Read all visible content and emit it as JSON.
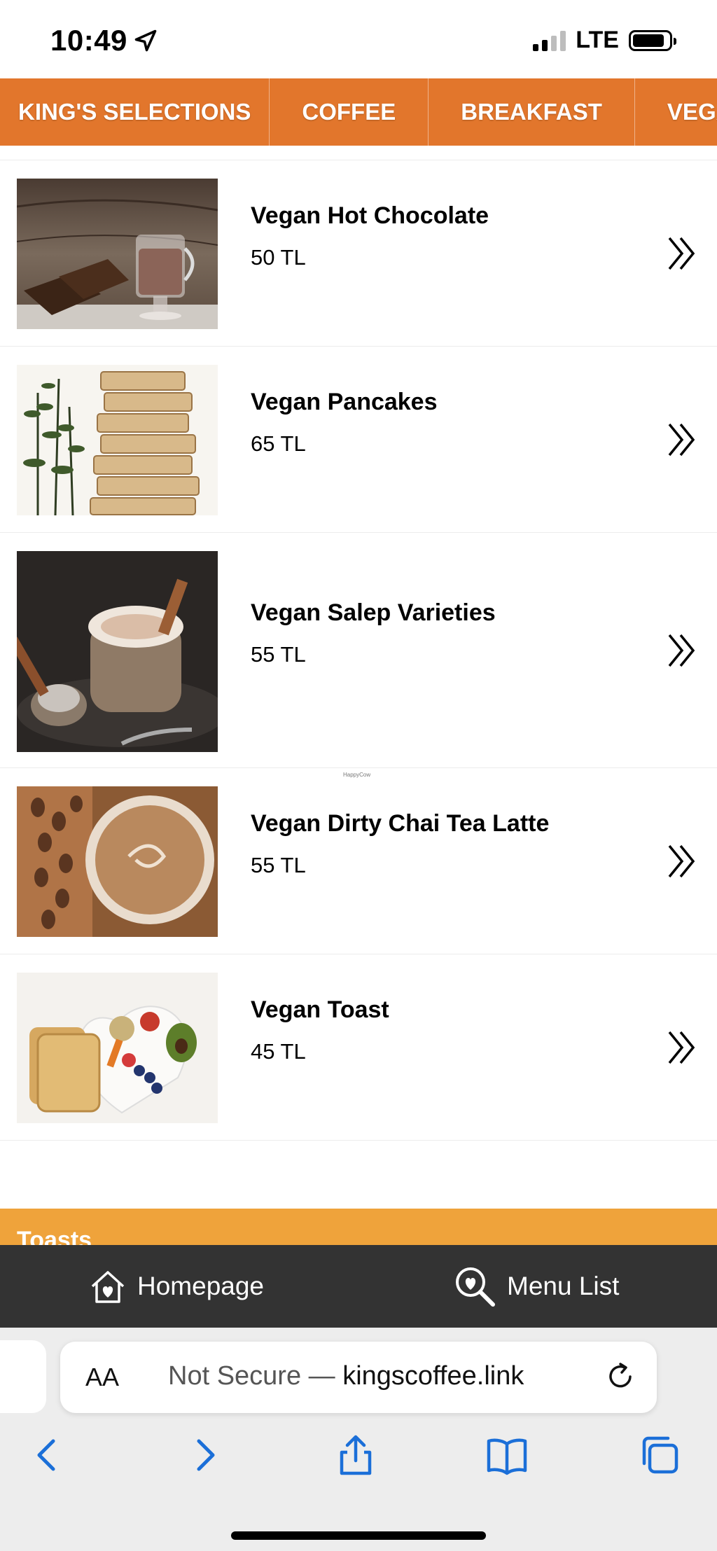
{
  "status_bar": {
    "time": "10:49",
    "network": "LTE",
    "icons": [
      "location-arrow-icon",
      "signal-icon",
      "battery-icon"
    ]
  },
  "categories": [
    "KING'S SELECTIONS",
    "COFFEE",
    "BREAKFAST",
    "VEGAN"
  ],
  "items": [
    {
      "name": "Vegan Hot Chocolate",
      "price": "50 TL"
    },
    {
      "name": "Vegan Pancakes",
      "price": "65 TL"
    },
    {
      "name": "Vegan Salep Varieties",
      "price": "55 TL"
    },
    {
      "name": "Vegan Dirty Chai Tea Latte",
      "price": "55 TL"
    },
    {
      "name": "Vegan Toast",
      "price": "45 TL"
    }
  ],
  "watermark": "HappyCow",
  "section": {
    "title": "Toasts"
  },
  "app_nav": {
    "home_label": "Homepage",
    "menu_label": "Menu List"
  },
  "browser": {
    "text_size_label": "AA",
    "security": "Not Secure",
    "separator": " — ",
    "domain": "kingscoffee.link"
  },
  "colors": {
    "nav_orange": "#e2762c",
    "section_orange": "#efa33b",
    "bottom_nav": "#333333",
    "browser_blue": "#1b6fd8"
  }
}
